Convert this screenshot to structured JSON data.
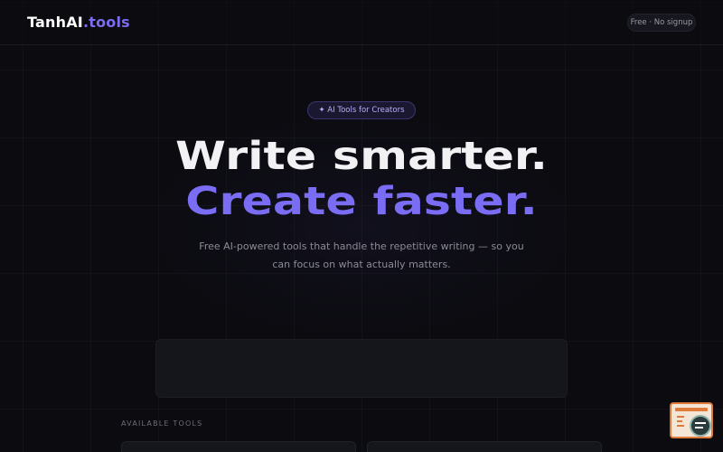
{
  "header": {
    "logo_main": "TanhAI",
    "logo_suffix": ".tools",
    "badge": "Free · No signup"
  },
  "hero": {
    "pill": "✦ AI Tools for Creators",
    "headline_line1": "Write smarter.",
    "headline_line2": "Create faster.",
    "subtitle": "Free AI-powered tools that handle the repetitive writing — so you can focus on what actually matters."
  },
  "tools_section": {
    "label": "AVAILABLE TOOLS"
  },
  "widget": {
    "icon": "chat-search-icon"
  },
  "colors": {
    "background": "#0b0b10",
    "accent": "#7a6df3",
    "headline": "#f2f2f4",
    "muted_text": "#8b8b98",
    "widget_orange": "#e07a3a"
  }
}
